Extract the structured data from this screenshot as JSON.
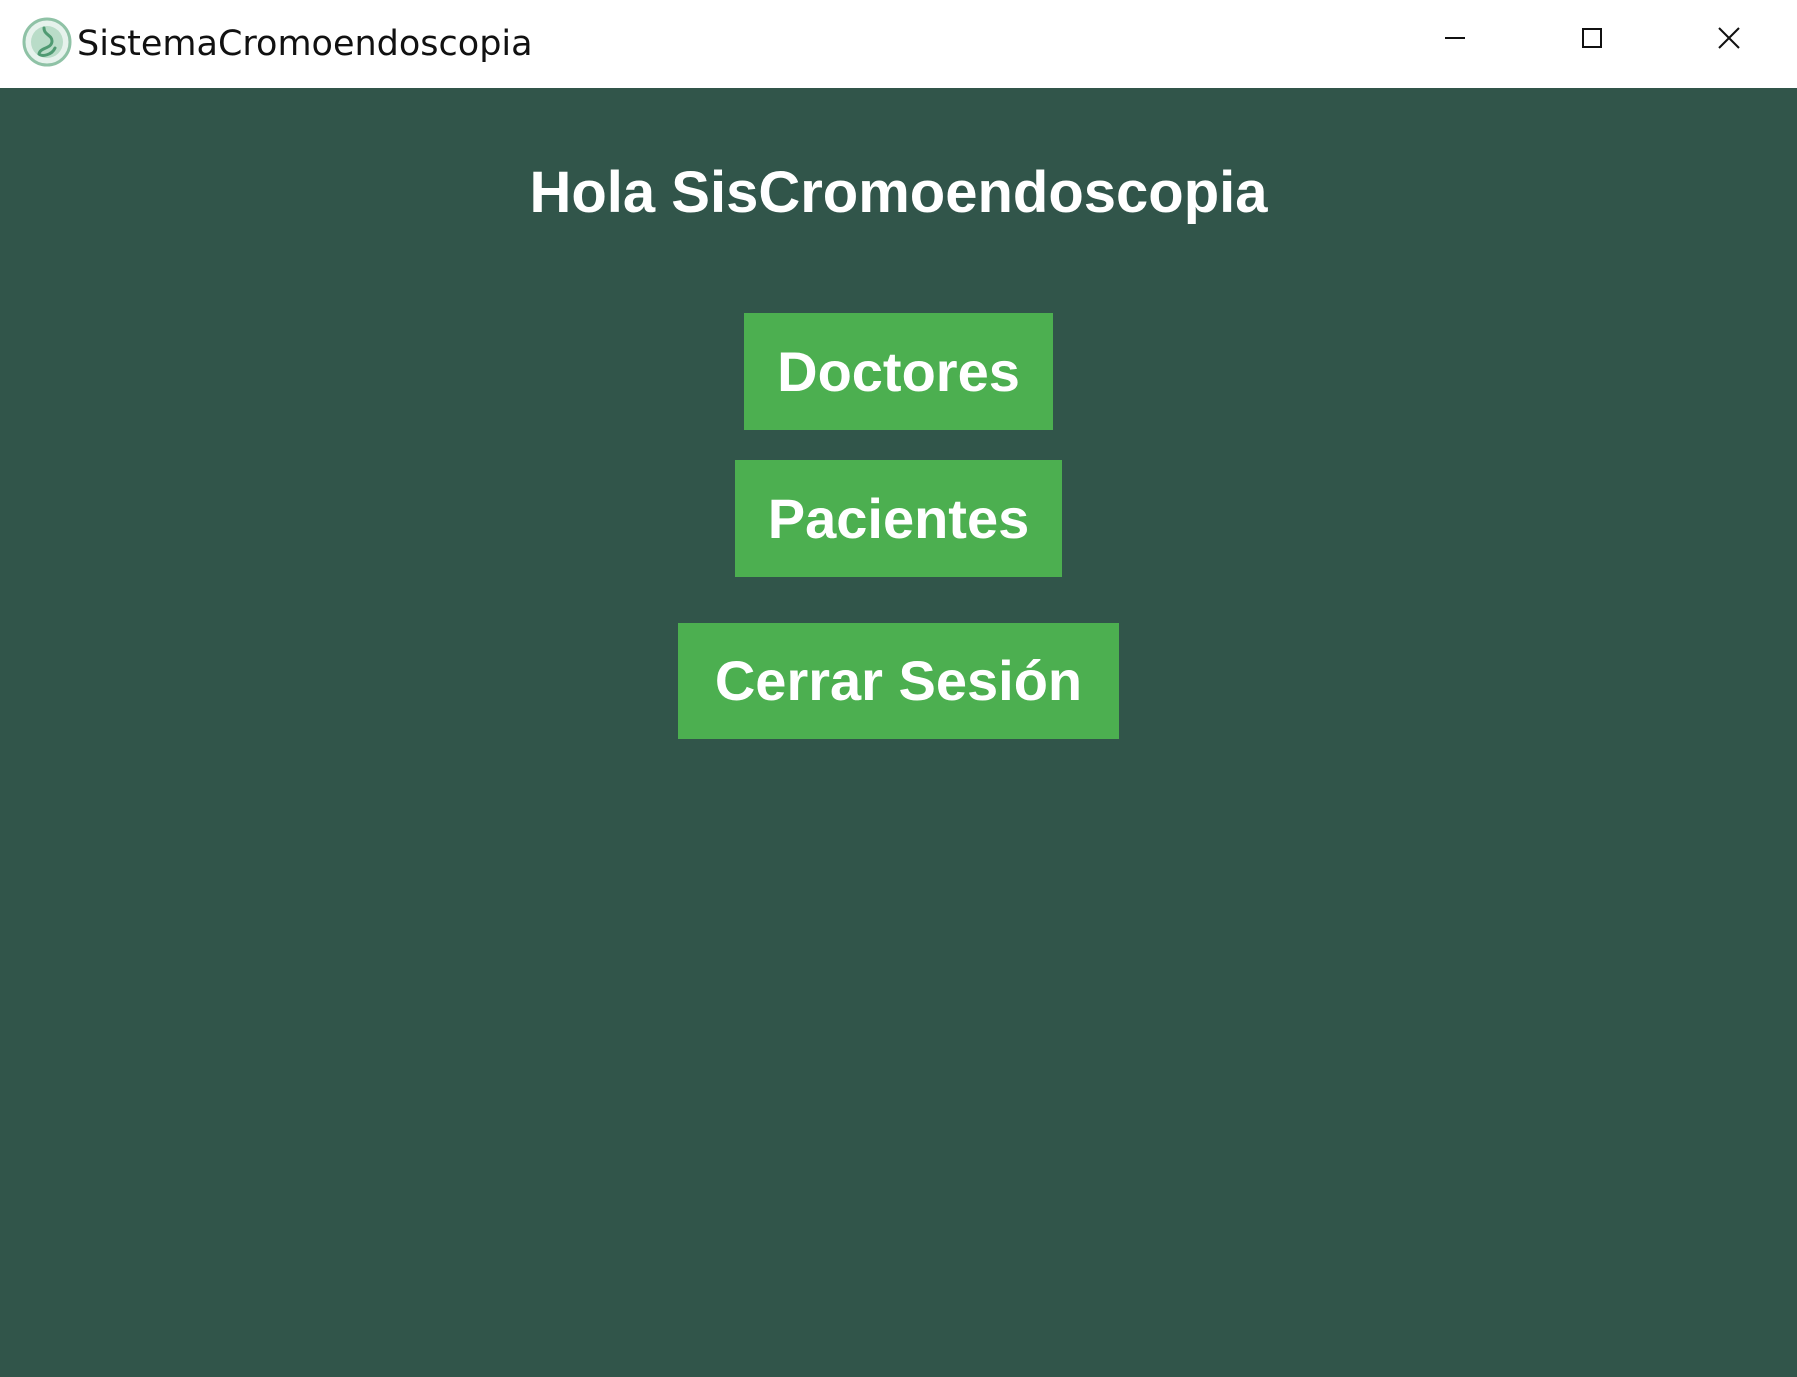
{
  "window": {
    "title": "SistemaCromoendoscopia",
    "icon": "stomach-logo-icon",
    "controls": {
      "minimize_icon": "minimize-icon",
      "maximize_icon": "maximize-icon",
      "close_icon": "close-icon"
    }
  },
  "main": {
    "greeting": "Hola SisCromoendoscopia",
    "buttons": {
      "doctores": "Doctores",
      "pacientes": "Pacientes",
      "cerrar_sesion": "Cerrar Sesión"
    }
  },
  "colors": {
    "background": "#31554a",
    "button": "#4caf50",
    "button_text": "#ffffff",
    "titlebar": "#ffffff"
  }
}
